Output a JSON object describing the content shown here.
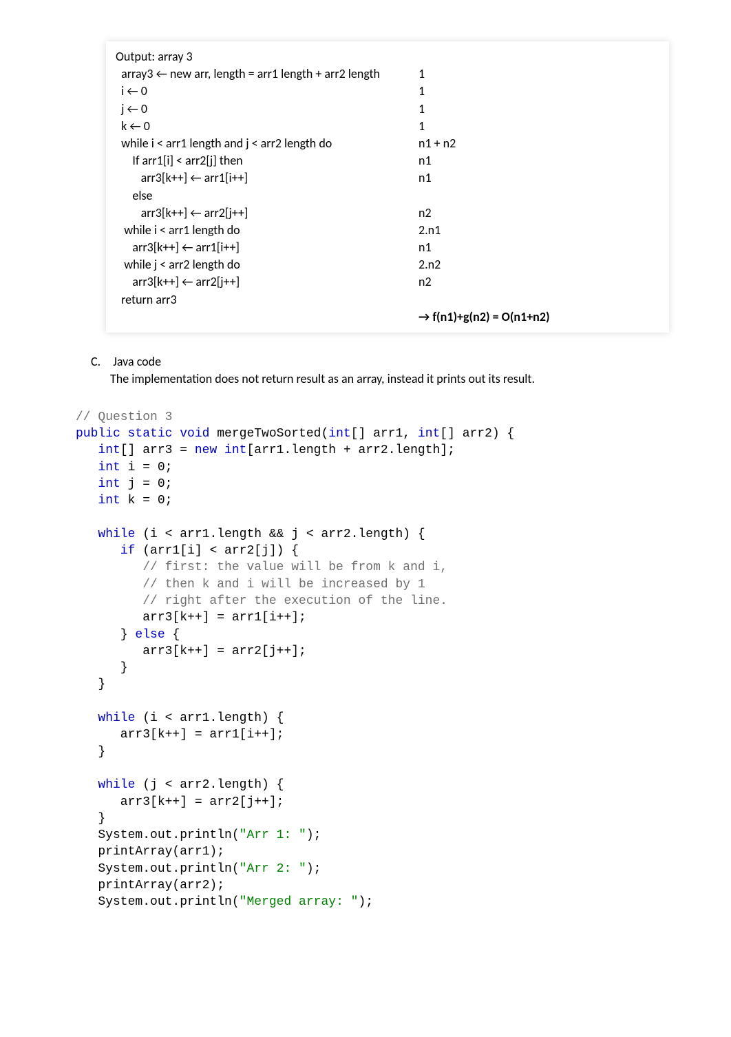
{
  "pseudo": {
    "rows": [
      {
        "left": "Output: array 3",
        "right": ""
      },
      {
        "left": "  array3 ← new arr, length = arr1 length + arr2 length",
        "right": "1"
      },
      {
        "left": "  i ← 0",
        "right": "1"
      },
      {
        "left": "  j ← 0",
        "right": "1"
      },
      {
        "left": "  k ← 0",
        "right": "1"
      },
      {
        "left": "  while i < arr1 length and j < arr2 length do",
        "right": "n1 + n2"
      },
      {
        "left": "      If arr1[i] < arr2[j] then",
        "right": "n1"
      },
      {
        "left": "         arr3[k++] ← arr1[i++]",
        "right": "n1"
      },
      {
        "left": "      else",
        "right": ""
      },
      {
        "left": "         arr3[k++] ← arr2[j++]",
        "right": "n2"
      },
      {
        "left": "   while i < arr1 length do",
        "right": "2.n1"
      },
      {
        "left": "      arr3[k++] ← arr1[i++]",
        "right": "n1"
      },
      {
        "left": "   while j < arr2 length do",
        "right": "2.n2"
      },
      {
        "left": "      arr3[k++] ← arr2[j++]",
        "right": "n2"
      },
      {
        "left": "  return arr3",
        "right": ""
      },
      {
        "left": "",
        "right": "→ f(n1)+g(n2) = O(n1+n2)"
      }
    ]
  },
  "sectionC": {
    "label": "C.",
    "title": "Java code",
    "desc": "The implementation does not return result as an array, instead it prints out its result."
  },
  "code": {
    "l1": "// Question 3",
    "l2a": "public static void",
    "l2b": " mergeTwoSorted(",
    "l2c": "int",
    "l2d": "[] arr1, ",
    "l2e": "int",
    "l2f": "[] arr2) {",
    "l3a": "   int",
    "l3b": "[] arr3 = ",
    "l3c": "new int",
    "l3d": "[arr1.length + arr2.length];",
    "l4a": "   int",
    "l4b": " i = ",
    "l4c": "0",
    "l4d": ";",
    "l5a": "   int",
    "l5b": " j = ",
    "l5c": "0",
    "l5d": ";",
    "l6a": "   int",
    "l6b": " k = ",
    "l6c": "0",
    "l6d": ";",
    "l7": "",
    "l8a": "   while",
    "l8b": " (i < arr1.length && j < arr2.length) {",
    "l9a": "      if",
    "l9b": " (arr1[i] < arr2[j]) {",
    "l10": "         // first: the value will be from k and i,",
    "l11": "         // then k and i will be increased by 1",
    "l12": "         // right after the execution of the line.",
    "l13": "         arr3[k++] = arr1[i++];",
    "l14a": "      } ",
    "l14b": "else",
    "l14c": " {",
    "l15": "         arr3[k++] = arr2[j++];",
    "l16": "      }",
    "l17": "   }",
    "l18": "",
    "l19a": "   while",
    "l19b": " (i < arr1.length) {",
    "l20": "      arr3[k++] = arr1[i++];",
    "l21": "   }",
    "l22": "",
    "l23a": "   while",
    "l23b": " (j < arr2.length) {",
    "l24": "      arr3[k++] = arr2[j++];",
    "l25": "   }",
    "l26a": "   System.out.println(",
    "l26b": "\"Arr 1: \"",
    "l26c": ");",
    "l27": "   printArray(arr1);",
    "l28a": "   System.out.println(",
    "l28b": "\"Arr 2: \"",
    "l28c": ");",
    "l29": "   printArray(arr2);",
    "l30a": "   System.out.println(",
    "l30b": "\"Merged array: \"",
    "l30c": ");"
  }
}
